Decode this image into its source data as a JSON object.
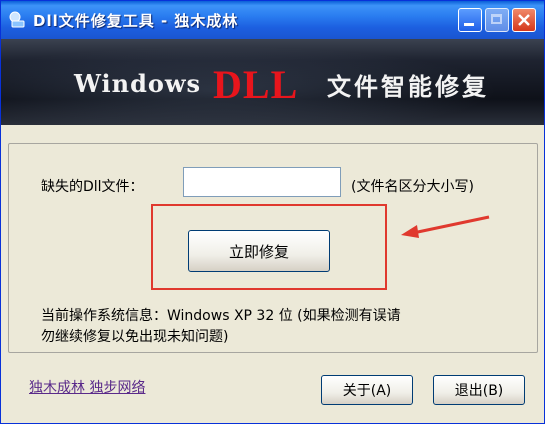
{
  "window": {
    "title": "Dll文件修复工具 - 独木成林",
    "controls": {
      "minimize": "minimize",
      "maximize": "maximize",
      "close": "close"
    }
  },
  "banner": {
    "windows_text": "Windows",
    "dll_text": "DLL",
    "cn_text": "文件智能修复"
  },
  "form": {
    "missing_label": "缺失的Dll文件：",
    "missing_value": "",
    "case_note": "(文件名区分大小写)",
    "repair_button": "立即修复",
    "os_info_line1": "当前操作系统信息：Windows XP    32 位 (如果检测有误请",
    "os_info_line2": "勿继续修复以免出现未知问题)"
  },
  "footer": {
    "link_text": "独木成林 独步网络",
    "about_button": "关于(A)",
    "exit_button": "退出(B)"
  },
  "colors": {
    "titlebar": "#2a7cf0",
    "dll_red": "#e8151c",
    "highlight": "#e0392e",
    "window_bg": "#ece9d8"
  },
  "icons": [
    "app-icon",
    "minimize-icon",
    "maximize-icon",
    "close-icon",
    "annotation-arrow-icon"
  ]
}
